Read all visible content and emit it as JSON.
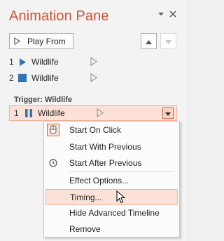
{
  "pane": {
    "title": "Animation Pane",
    "dropdown_icon": "chevron-down-icon",
    "close_icon": "close-icon",
    "play_from_label": "Play From",
    "move_up_icon": "triangle-up-icon",
    "move_down_icon": "triangle-down-icon"
  },
  "animations": [
    {
      "num": "1",
      "effect_icon": "play-icon",
      "label": "Wildlife",
      "timing_icon": "timing-triangle-icon"
    },
    {
      "num": "2",
      "effect_icon": "stop-icon",
      "label": "Wildlife",
      "timing_icon": "timing-triangle-icon"
    }
  ],
  "trigger": {
    "label": "Trigger: Wildlife",
    "item": {
      "num": "1",
      "effect_icon": "pause-icon",
      "label": "Wildlife",
      "timing_icon": "timing-triangle-icon"
    }
  },
  "context_menu": {
    "items": [
      {
        "label": "Start On Click",
        "icon": "mouse-click-icon"
      },
      {
        "label": "Start With Previous",
        "icon": ""
      },
      {
        "label": "Start After Previous",
        "icon": "clock-icon"
      },
      {
        "label": "Effect Options...",
        "icon": ""
      },
      {
        "label": "Timing...",
        "icon": ""
      },
      {
        "label": "Hide Advanced Timeline",
        "icon": ""
      },
      {
        "label": "Remove",
        "icon": ""
      }
    ],
    "hovered": "Timing..."
  },
  "colors": {
    "accent": "#d35230",
    "highlight": "#fbe1d7",
    "highlight_border": "#f1b49b",
    "effect_blue": "#2e75b6"
  }
}
